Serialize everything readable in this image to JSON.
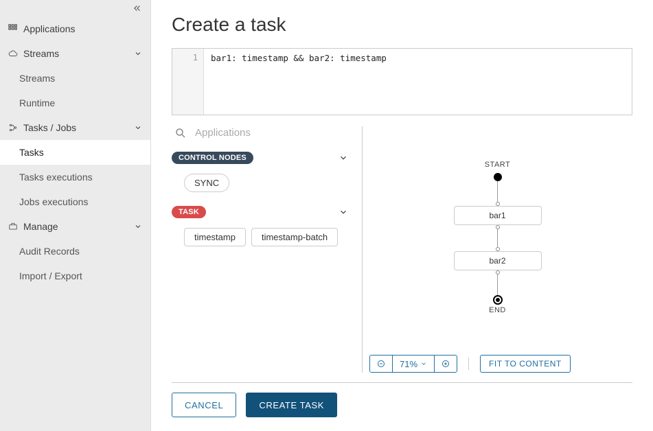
{
  "sidebar": {
    "items": [
      {
        "label": "Applications"
      },
      {
        "label": "Streams",
        "children": [
          "Streams",
          "Runtime"
        ]
      },
      {
        "label": "Tasks / Jobs",
        "children": [
          "Tasks",
          "Tasks executions",
          "Jobs executions"
        ],
        "selected_child_index": 0
      },
      {
        "label": "Manage",
        "children": [
          "Audit Records",
          "Import / Export"
        ]
      }
    ]
  },
  "header": {
    "title": "Create a task"
  },
  "editor": {
    "line_no": "1",
    "code": "bar1: timestamp && bar2: timestamp"
  },
  "palette": {
    "search_placeholder": "Applications",
    "groups": [
      {
        "name": "CONTROL NODES",
        "color": "gray",
        "items": [
          "SYNC"
        ],
        "item_style": "chip"
      },
      {
        "name": "TASK",
        "color": "red",
        "items": [
          "timestamp",
          "timestamp-batch"
        ],
        "item_style": "box"
      }
    ]
  },
  "graph": {
    "start_label": "START",
    "end_label": "END",
    "nodes": [
      "bar1",
      "bar2"
    ]
  },
  "toolbar": {
    "zoom": "71%",
    "fit_label": "FIT TO CONTENT"
  },
  "actions": {
    "cancel": "CANCEL",
    "create": "CREATE TASK"
  }
}
